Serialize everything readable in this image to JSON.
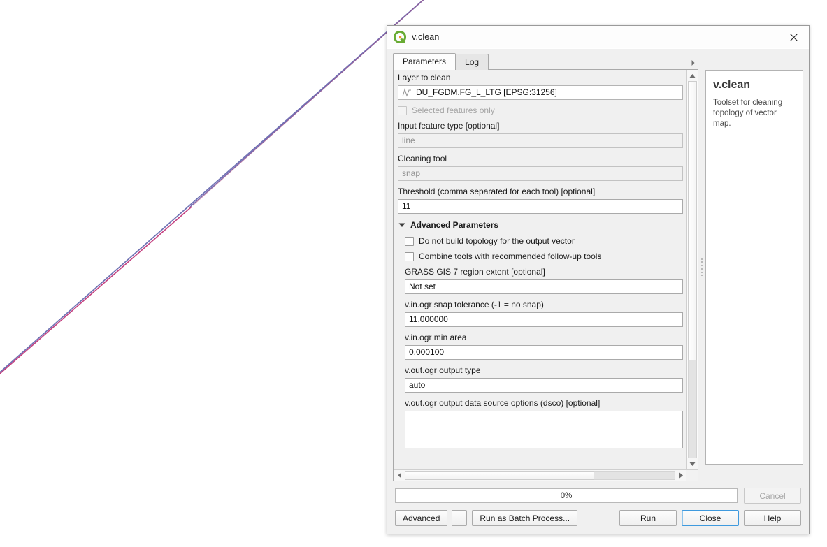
{
  "window": {
    "title": "v.clean",
    "icon": "qgis-logo-icon",
    "close_label": "✕"
  },
  "tabs": [
    {
      "label": "Parameters",
      "active": true
    },
    {
      "label": "Log",
      "active": false
    }
  ],
  "parameters": {
    "layer_to_clean": {
      "label": "Layer to clean",
      "value": "DU_FGDM.FG_L_LTG [EPSG:31256]",
      "icon": "line-geometry-icon"
    },
    "selected_features_only": {
      "label": "Selected features only",
      "checked": false,
      "disabled": true
    },
    "input_feature_type": {
      "label": "Input feature type [optional]",
      "value": "line",
      "is_placeholder": true
    },
    "cleaning_tool": {
      "label": "Cleaning tool",
      "value": "snap",
      "is_placeholder": true
    },
    "threshold": {
      "label": "Threshold (comma separated for each tool) [optional]",
      "value": "11"
    },
    "advanced_group": {
      "label": "Advanced Parameters",
      "expanded": true
    },
    "no_build_topology": {
      "label": "Do not build topology for the output vector",
      "checked": false
    },
    "combine_tools": {
      "label": "Combine tools with recommended follow-up tools",
      "checked": false
    },
    "region_extent": {
      "label": "GRASS GIS 7 region extent [optional]",
      "value": "Not set"
    },
    "snap_tolerance": {
      "label": "v.in.ogr snap tolerance (-1 = no snap)",
      "value": "11,000000"
    },
    "min_area": {
      "label": "v.in.ogr min area",
      "value": "0,000100"
    },
    "output_type": {
      "label": "v.out.ogr output type",
      "value": "auto"
    },
    "dsco": {
      "label": "v.out.ogr output data source options (dsco) [optional]",
      "value": ""
    }
  },
  "help": {
    "title": "v.clean",
    "text": "Toolset for cleaning topology of vector map."
  },
  "footer": {
    "progress_text": "0%",
    "progress_percent": 0,
    "cancel_label": "Cancel",
    "advanced_label": "Advanced",
    "batch_label": "Run as Batch Process...",
    "run_label": "Run",
    "close_label": "Close",
    "help_label": "Help"
  },
  "colors": {
    "dialog_background": "#f0f0f0",
    "field_background": "#ffffff",
    "focus_ring": "#3f9ade",
    "map_line_blue": "#6f72b4",
    "map_line_pink": "#c4407f",
    "qgis_green": "#5aa832",
    "qgis_orange": "#f0952a"
  },
  "map": {
    "line_blue_label": "map-line-blue",
    "line_pink_label": "map-line-pink"
  }
}
